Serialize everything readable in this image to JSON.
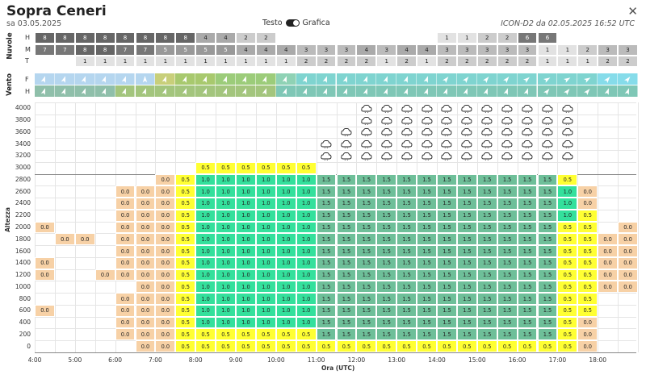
{
  "header": {
    "title": "Sopra Ceneri",
    "date": "sa 03.05.2025",
    "toggle_left": "Testo",
    "toggle_right": "Grafica",
    "model": "ICON-D2 da 02.05.2025 16:52 UTC",
    "close_icon": "close-icon"
  },
  "clouds": {
    "section_label": "Nuvole",
    "rows": [
      {
        "label": "H",
        "values": [
          "8",
          "8",
          "8",
          "8",
          "8",
          "8",
          "8",
          "8",
          "4",
          "4",
          "2",
          "2",
          "",
          "",
          "",
          "",
          "",
          "",
          "",
          "",
          "1",
          "1",
          "2",
          "2",
          "6",
          "6",
          "",
          "",
          "",
          ""
        ]
      },
      {
        "label": "M",
        "values": [
          "7",
          "7",
          "8",
          "8",
          "7",
          "7",
          "5",
          "5",
          "5",
          "5",
          "4",
          "4",
          "4",
          "3",
          "3",
          "3",
          "4",
          "3",
          "4",
          "4",
          "3",
          "3",
          "3",
          "3",
          "3",
          "1",
          "1",
          "2",
          "3",
          "3"
        ]
      },
      {
        "label": "T",
        "values": [
          "",
          "",
          "1",
          "1",
          "1",
          "1",
          "1",
          "1",
          "1",
          "1",
          "1",
          "1",
          "1",
          "2",
          "2",
          "2",
          "2",
          "1",
          "2",
          "1",
          "2",
          "2",
          "2",
          "2",
          "2",
          "1",
          "1",
          "1",
          "2",
          "2"
        ]
      }
    ]
  },
  "wind": {
    "section_label": "Vento",
    "rows": [
      {
        "label": "F"
      },
      {
        "label": "H"
      }
    ]
  },
  "chart": {
    "xlabel": "Ora (UTC)",
    "ylabel": "Altezza",
    "yticks": [
      "0",
      "200",
      "400",
      "600",
      "800",
      "1000",
      "1200",
      "1400",
      "1600",
      "1800",
      "2000",
      "2200",
      "2400",
      "2600",
      "2800",
      "3000",
      "3200",
      "3400",
      "3600",
      "3800",
      "4000"
    ],
    "xticks": [
      "4:00",
      "5:00",
      "6:00",
      "7:00",
      "8:00",
      "9:00",
      "10:00",
      "11:00",
      "12:00",
      "13:00",
      "14:00",
      "15:00",
      "16:00",
      "17:00",
      "18:00"
    ]
  }
}
